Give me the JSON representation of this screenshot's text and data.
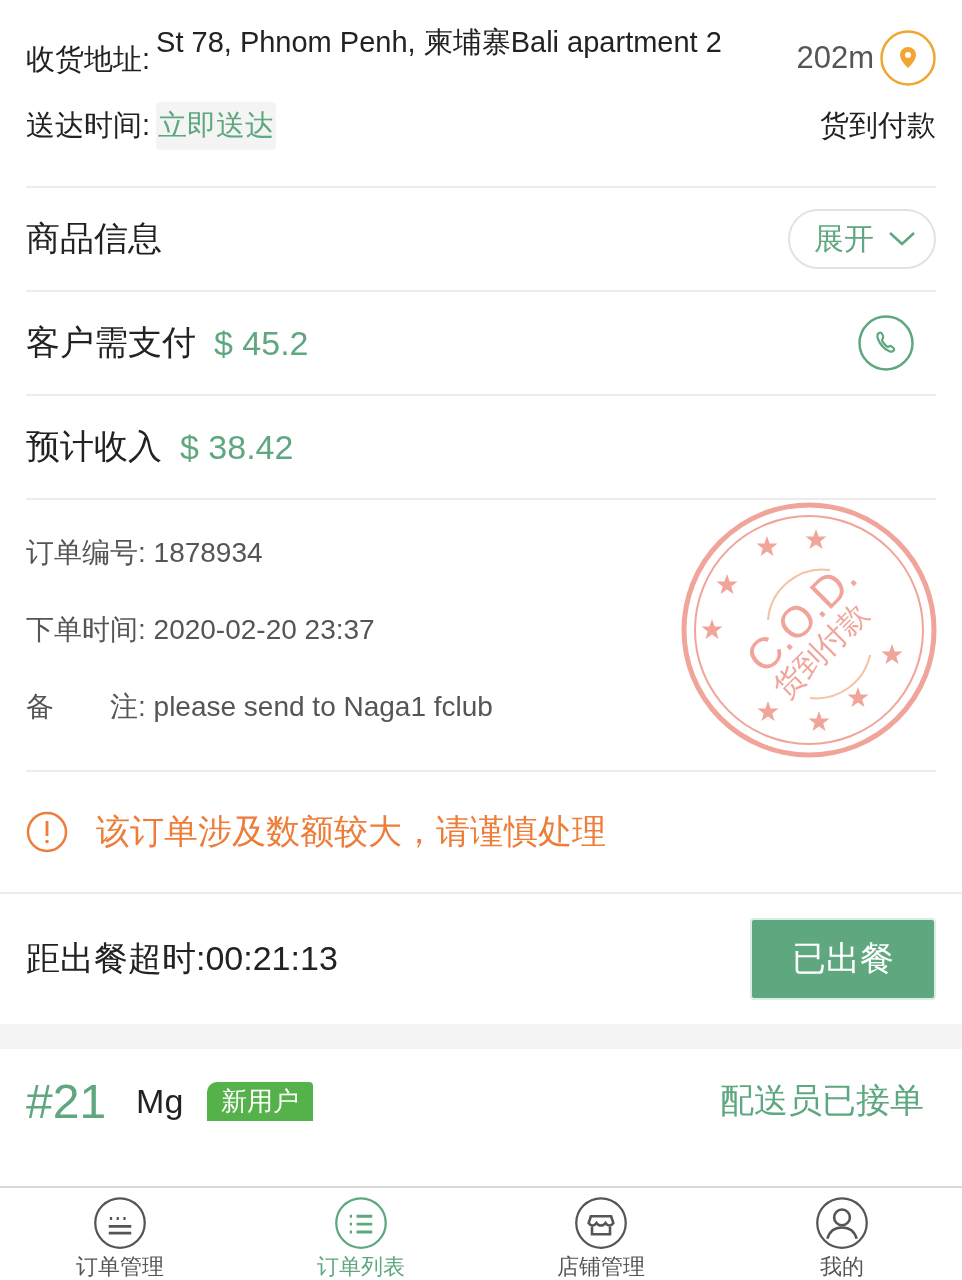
{
  "address": {
    "label": "收货地址:",
    "value": "St 78, Phnom Penh, 柬埔寨Bali apartment 2",
    "distance": "202m"
  },
  "delivery": {
    "label": "送达时间:",
    "value": "立即送达",
    "payment": "货到付款"
  },
  "goods": {
    "title": "商品信息",
    "toggle": "展开",
    "expanded": false
  },
  "customer_pay": {
    "label": "客户需支付",
    "amount": "$ 45.2"
  },
  "income": {
    "label": "预计收入",
    "amount": "$ 38.42"
  },
  "details": [
    {
      "label": "订单编号:",
      "value": "1878934"
    },
    {
      "label": "下单时间:",
      "value": "2020-02-20 23:37"
    },
    {
      "label": "备　　注:",
      "value": "please send to Naga1 fclub"
    }
  ],
  "stamp": {
    "code": "C.O.D.",
    "text": "货到付款"
  },
  "warning": "该订单涉及数额较大，请谨慎处理",
  "countdown": {
    "text": "距出餐超时:00:21:13",
    "button": "已出餐"
  },
  "next_order": {
    "number": "#21",
    "name": "Mg",
    "badge": "新用户",
    "status": "配送员已接单"
  },
  "tabs": [
    {
      "label": "订单管理",
      "kind": "notes",
      "selected": false
    },
    {
      "label": "订单列表",
      "kind": "list",
      "selected": true
    },
    {
      "label": "店铺管理",
      "kind": "shop",
      "selected": false
    },
    {
      "label": "我的",
      "kind": "user",
      "selected": false
    }
  ]
}
